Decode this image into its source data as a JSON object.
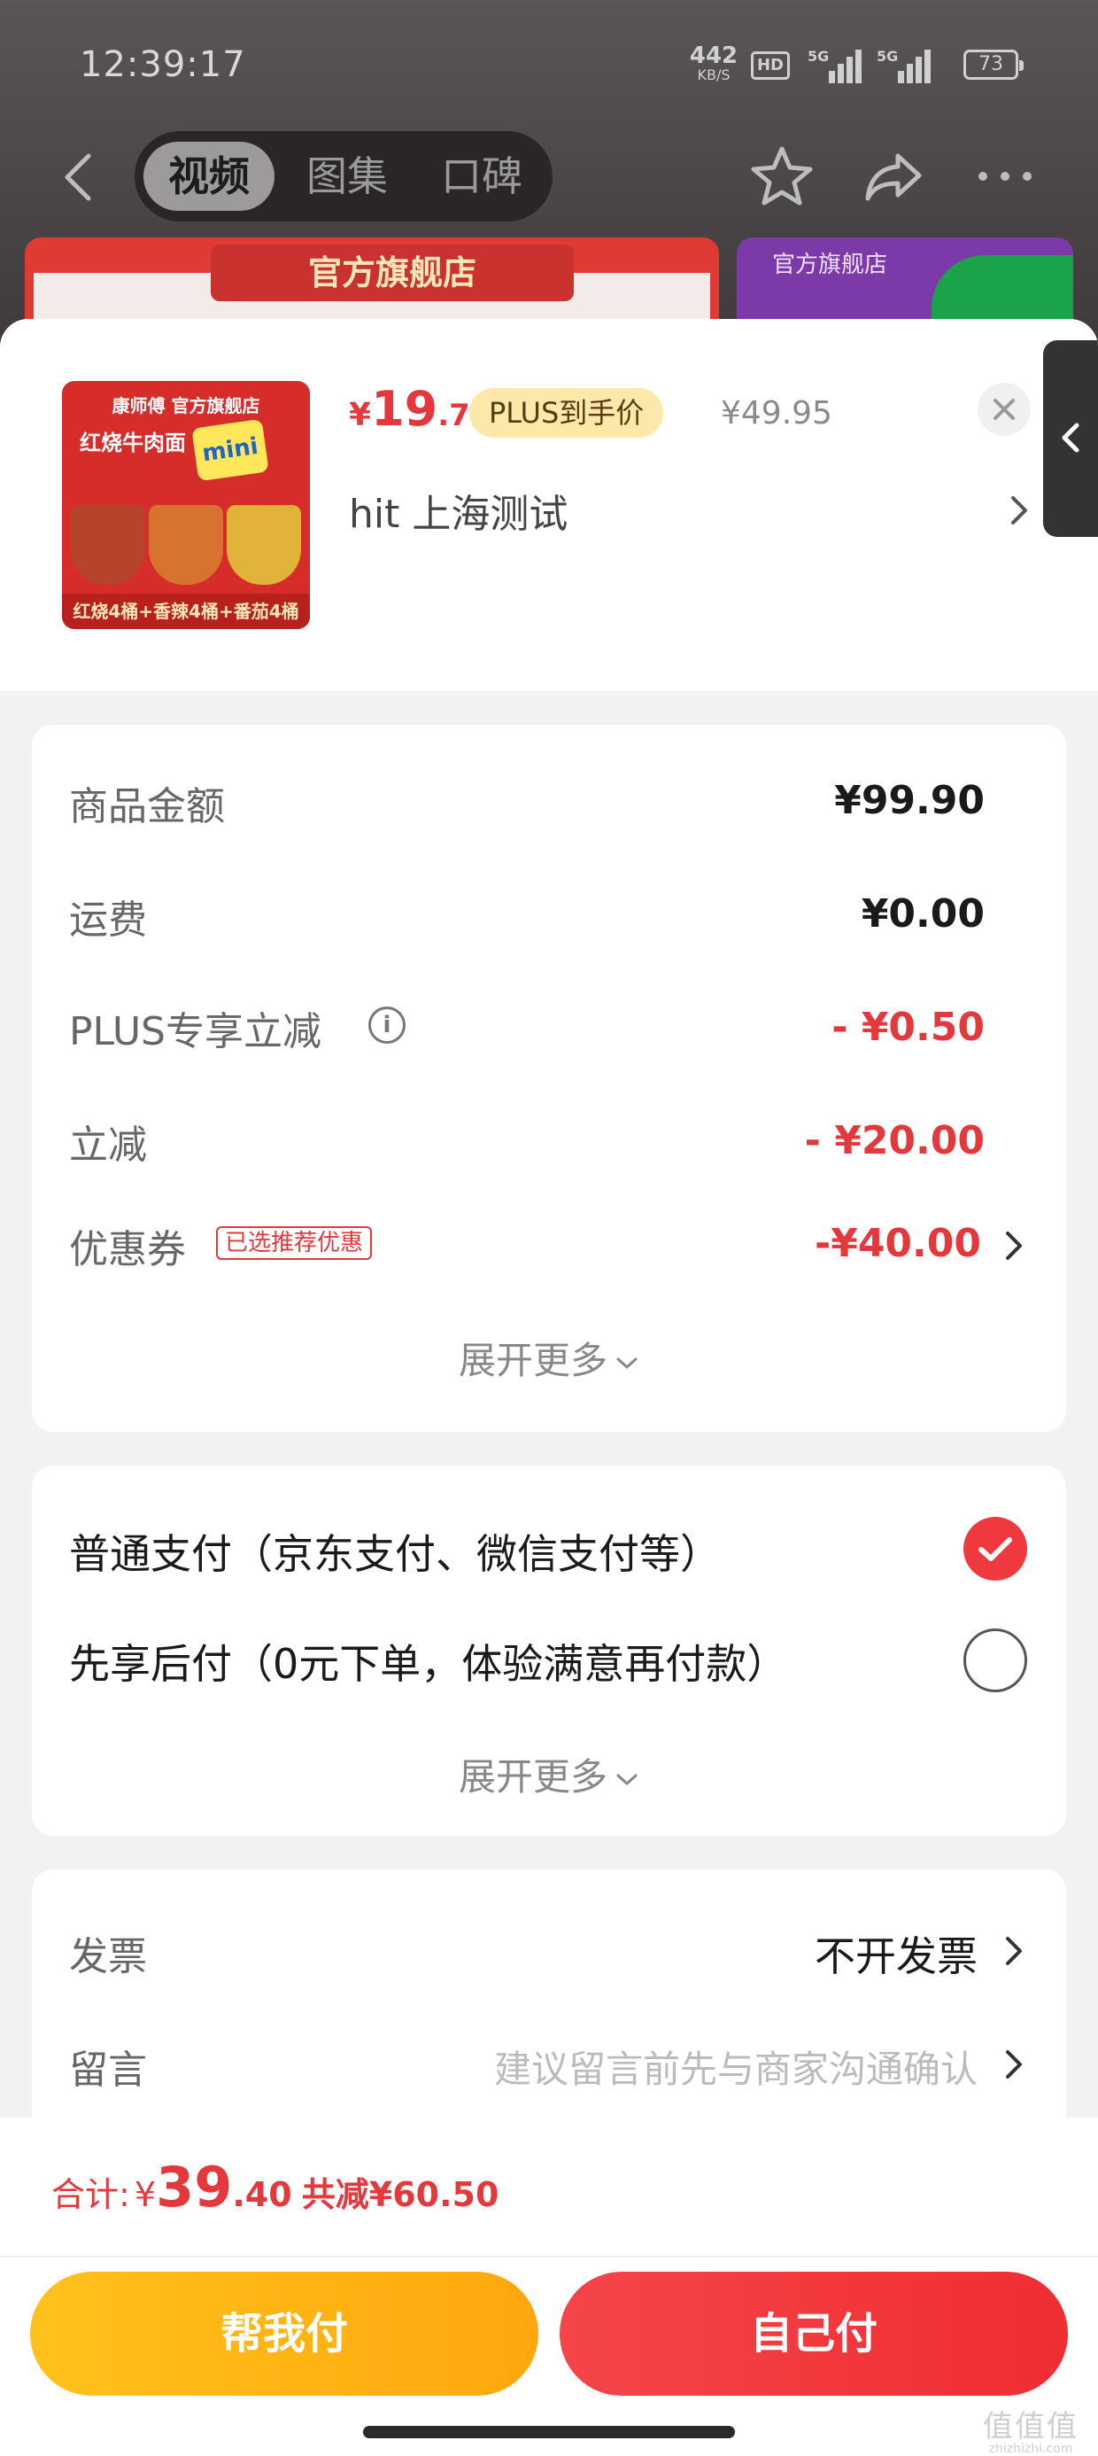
{
  "status": {
    "time": "12:39:17",
    "speed": "442",
    "speed_unit": "KB/S",
    "hd": "HD",
    "sig1": "5G",
    "sig2": "5G",
    "battery": "73"
  },
  "nav": {
    "tabs": [
      "视频",
      "图集",
      "口碑"
    ],
    "active_tab": "视频"
  },
  "banner": {
    "store_name": "官方旗舰店",
    "store_name_2": "官方旗舰店"
  },
  "product": {
    "image_top": "康师傅 官方旗舰店",
    "image_title": "红烧牛肉面",
    "image_badge": "mini",
    "image_footer": "红烧4桶+香辣4桶+番茄4桶",
    "price_currency": "¥",
    "price_int": "19",
    "price_dec": ".7",
    "plus_badge": "PLUS到手价",
    "original_price": "¥49.95",
    "address": "hit  上海测试"
  },
  "summary": {
    "rows": [
      {
        "label": "商品金额",
        "value": "¥99.90"
      },
      {
        "label": "运费",
        "value": "¥0.00"
      },
      {
        "label": "PLUS专享立减",
        "value": "- ¥0.50"
      },
      {
        "label": "立减",
        "value": "- ¥20.00"
      },
      {
        "label": "优惠券",
        "value": "-¥40.00"
      }
    ],
    "coupon_tag": "已选推荐优惠",
    "expand": "展开更多"
  },
  "payment": {
    "options": [
      {
        "label": "普通支付（京东支付、微信支付等）",
        "selected": true
      },
      {
        "label": "先享后付（0元下单，体验满意再付款）",
        "selected": false
      }
    ],
    "expand": "展开更多"
  },
  "extra": {
    "invoice_label": "发票",
    "invoice_value": "不开发票",
    "message_label": "留言",
    "message_placeholder": "建议留言前先与商家沟通确认"
  },
  "footer": {
    "total_label": "合计:",
    "total_currency": "¥",
    "total_int": "39",
    "total_dec": ".40",
    "total_saving": "共减¥60.50",
    "btn_helper": "帮我付",
    "btn_self": "自己付",
    "watermark_big": "值值值",
    "watermark_small": "zhizhizhi.com"
  },
  "colors": {
    "accent_red": "#e4393c",
    "plus_gold": "#fce8a8",
    "btn_yellow": "#ffb516",
    "btn_red": "#f0393e"
  },
  "icons": [
    "back-arrow-icon",
    "star-icon",
    "share-icon",
    "more-icon",
    "close-icon",
    "chevron-right-icon",
    "info-icon",
    "chevron-down-icon",
    "check-icon"
  ]
}
